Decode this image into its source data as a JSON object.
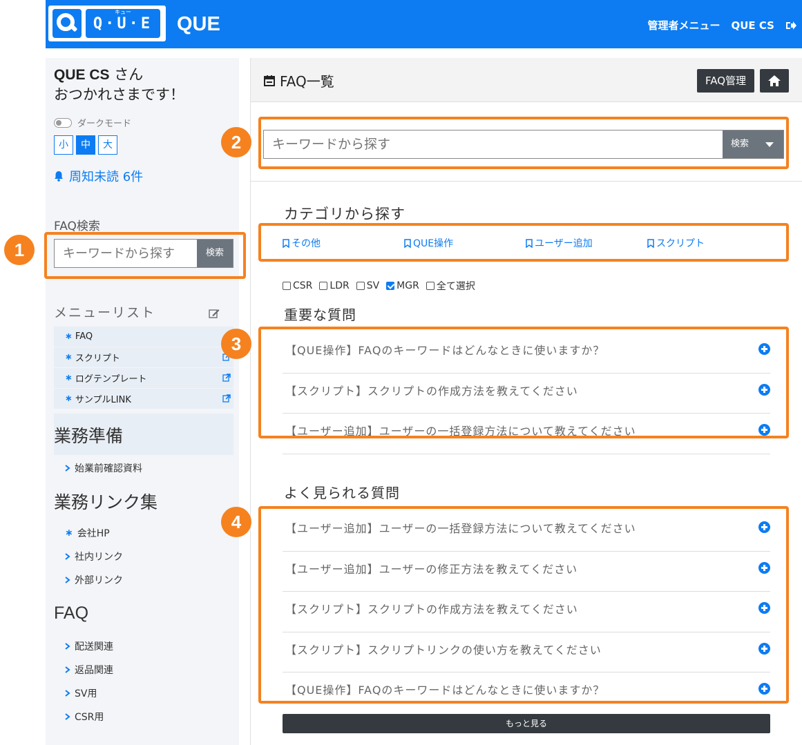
{
  "header": {
    "logo_text": "Q·U·E",
    "logo_kana": "キュー",
    "brand": "QUE",
    "admin_menu": "管理者メニュー",
    "user": "QUE CS",
    "bg_color": "#0d7cf2"
  },
  "sidebar": {
    "greeting_name": "QUE CS",
    "greeting_suffix": " さん",
    "greeting_line2": "おつかれさまです！",
    "dark_mode": "ダークモード",
    "sizes": [
      "小",
      "中",
      "大"
    ],
    "size_selected": "中",
    "notice": "周知未読 6件",
    "faq_search_label": "FAQ検索",
    "search_placeholder": "キーワードから探す",
    "search_button": "検索",
    "menulist_label": "メニューリスト",
    "menu_items": [
      {
        "label": "FAQ",
        "external": false
      },
      {
        "label": "スクリプト",
        "external": true
      },
      {
        "label": "ログテンプレート",
        "external": true
      },
      {
        "label": "サンプルLINK",
        "external": true
      }
    ],
    "section_prep": "業務準備",
    "prep_items": [
      "始業前確認資料"
    ],
    "section_links": "業務リンク集",
    "link_items": [
      {
        "label": "会社HP",
        "type": "star"
      },
      {
        "label": "社内リンク",
        "type": "chevron"
      },
      {
        "label": "外部リンク",
        "type": "chevron"
      }
    ],
    "section_faq": "FAQ",
    "faq_items": [
      "配送関連",
      "返品関連",
      "SV用",
      "CSR用"
    ]
  },
  "main": {
    "title": "FAQ一覧",
    "faq_admin_button": "FAQ管理",
    "search_placeholder": "キーワードから探す",
    "search_button": "検索",
    "category_title": "カテゴリから探す",
    "categories": [
      "その他",
      "QUE操作",
      "ユーザー追加",
      "スクリプト"
    ],
    "filters": [
      {
        "label": "CSR",
        "checked": false
      },
      {
        "label": "LDR",
        "checked": false
      },
      {
        "label": "SV",
        "checked": false
      },
      {
        "label": "MGR",
        "checked": true
      },
      {
        "label": "全て選択",
        "checked": false
      }
    ],
    "important_title": "重要な質問",
    "important_questions": [
      "【QUE操作】FAQのキーワードはどんなときに使いますか？",
      "【スクリプト】スクリプトの作成方法を教えてください",
      "【ユーザー追加】ユーザーの一括登録方法について教えてください"
    ],
    "popular_title": "よく見られる質問",
    "popular_questions": [
      "【ユーザー追加】ユーザーの一括登録方法について教えてください",
      "【ユーザー追加】ユーザーの修正方法を教えてください",
      "【スクリプト】スクリプトの作成方法を教えてください",
      "【スクリプト】スクリプトリンクの使い方を教えてください",
      "【QUE操作】FAQのキーワードはどんなときに使いますか？"
    ],
    "more_button": "もっと見る"
  },
  "annotations": {
    "badges": [
      "1",
      "2",
      "3",
      "4"
    ],
    "color": "#f5821f"
  }
}
